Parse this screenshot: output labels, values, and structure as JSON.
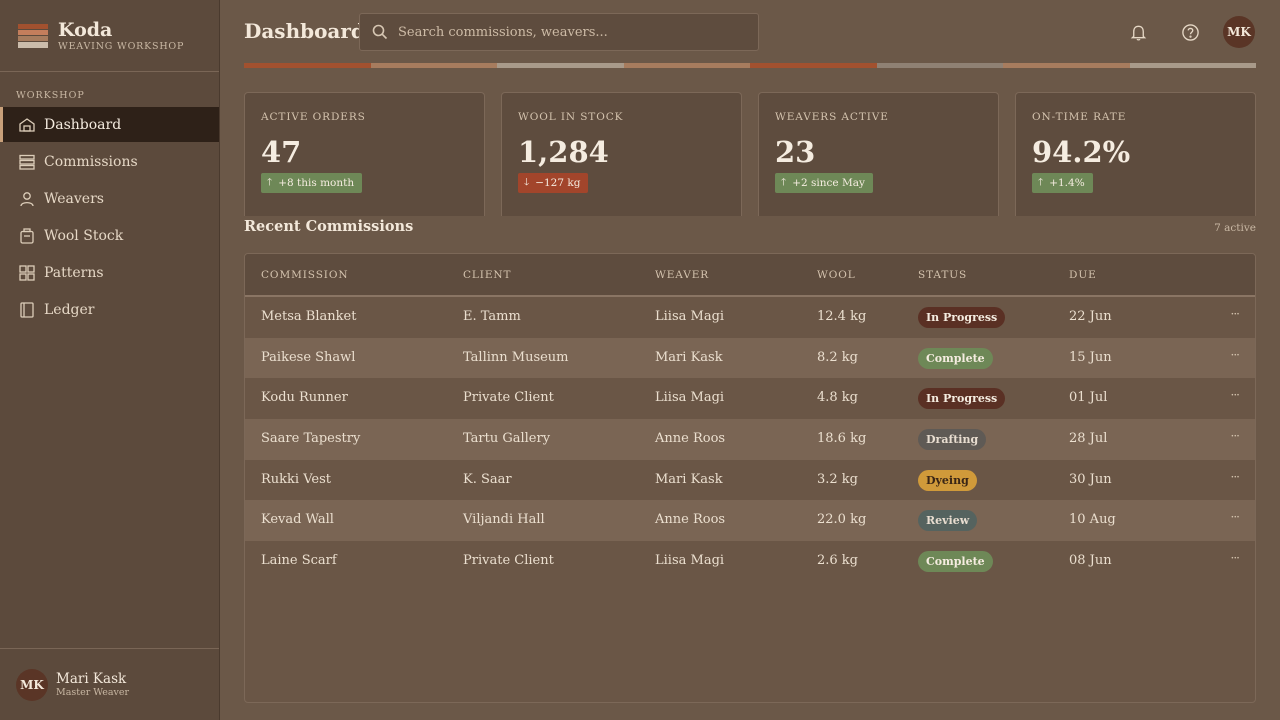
{
  "app": {
    "name": "Koda",
    "subtitle": "Weaving Workshop"
  },
  "sidebar": {
    "section": "Workshop",
    "items": [
      {
        "label": "Dashboard",
        "icon": "home-icon",
        "active": true
      },
      {
        "label": "Commissions",
        "icon": "stack-icon"
      },
      {
        "label": "Weavers",
        "icon": "person-icon"
      },
      {
        "label": "Wool Stock",
        "icon": "jar-icon"
      },
      {
        "label": "Patterns",
        "icon": "grid-icon"
      },
      {
        "label": "Ledger",
        "icon": "book-icon"
      }
    ],
    "user": {
      "initials": "MK",
      "name": "Mari Kask",
      "role": "Master Weaver"
    }
  },
  "header": {
    "title": "Dashboard",
    "search_placeholder": "Search commissions, weavers...",
    "avatar_initials": "MK"
  },
  "colors": {
    "weave": [
      "#a2512f",
      "#a77c5e",
      "#a89a8a",
      "#a77c5e",
      "#a2512f",
      "#8f8174",
      "#a77c5e",
      "#a89a8a"
    ],
    "up": "#6e8857",
    "down": "#a2452b"
  },
  "stats": [
    {
      "label": "Active Orders",
      "value": "47",
      "delta": "+8 this month",
      "direction": "up"
    },
    {
      "label": "Wool in Stock",
      "value": "1,284",
      "delta": "−127 kg",
      "direction": "down"
    },
    {
      "label": "Weavers Active",
      "value": "23",
      "delta": "+2 since May",
      "direction": "up"
    },
    {
      "label": "On-Time Rate",
      "value": "94.2%",
      "delta": "+1.4%",
      "direction": "up"
    }
  ],
  "commissions": {
    "title": "Recent Commissions",
    "count": "7 active",
    "columns": [
      "Commission",
      "Client",
      "Weaver",
      "Wool",
      "Status",
      "Due"
    ],
    "rows": [
      {
        "commission": "Metsa Blanket",
        "client": "E. Tamm",
        "weaver": "Liisa Magi",
        "wool": "12.4 kg",
        "status": "In Progress",
        "due": "22 Jun"
      },
      {
        "commission": "Paikese Shawl",
        "client": "Tallinn Museum",
        "weaver": "Mari Kask",
        "wool": "8.2 kg",
        "status": "Complete",
        "due": "15 Jun"
      },
      {
        "commission": "Kodu Runner",
        "client": "Private Client",
        "weaver": "Liisa Magi",
        "wool": "4.8 kg",
        "status": "In Progress",
        "due": "01 Jul"
      },
      {
        "commission": "Saare Tapestry",
        "client": "Tartu Gallery",
        "weaver": "Anne Roos",
        "wool": "18.6 kg",
        "status": "Drafting",
        "due": "28 Jul"
      },
      {
        "commission": "Rukki Vest",
        "client": "K. Saar",
        "weaver": "Mari Kask",
        "wool": "3.2 kg",
        "status": "Dyeing",
        "due": "30 Jun"
      },
      {
        "commission": "Kevad Wall",
        "client": "Viljandi Hall",
        "weaver": "Anne Roos",
        "wool": "22.0 kg",
        "status": "Review",
        "due": "10 Aug"
      },
      {
        "commission": "Laine Scarf",
        "client": "Private Client",
        "weaver": "Liisa Magi",
        "wool": "2.6 kg",
        "status": "Complete",
        "due": "08 Jun"
      }
    ],
    "status_colors": {
      "In Progress": {
        "bg": "#5a3024",
        "fg": "#f5ece0"
      },
      "Complete": {
        "bg": "#6e8857",
        "fg": "#f5ece0"
      },
      "Drafting": {
        "bg": "#5f5a55",
        "fg": "#e8ddd0"
      },
      "Dyeing": {
        "bg": "#d09a3a",
        "fg": "#3a2616"
      },
      "Review": {
        "bg": "#55635f",
        "fg": "#e8ddd0"
      }
    }
  }
}
